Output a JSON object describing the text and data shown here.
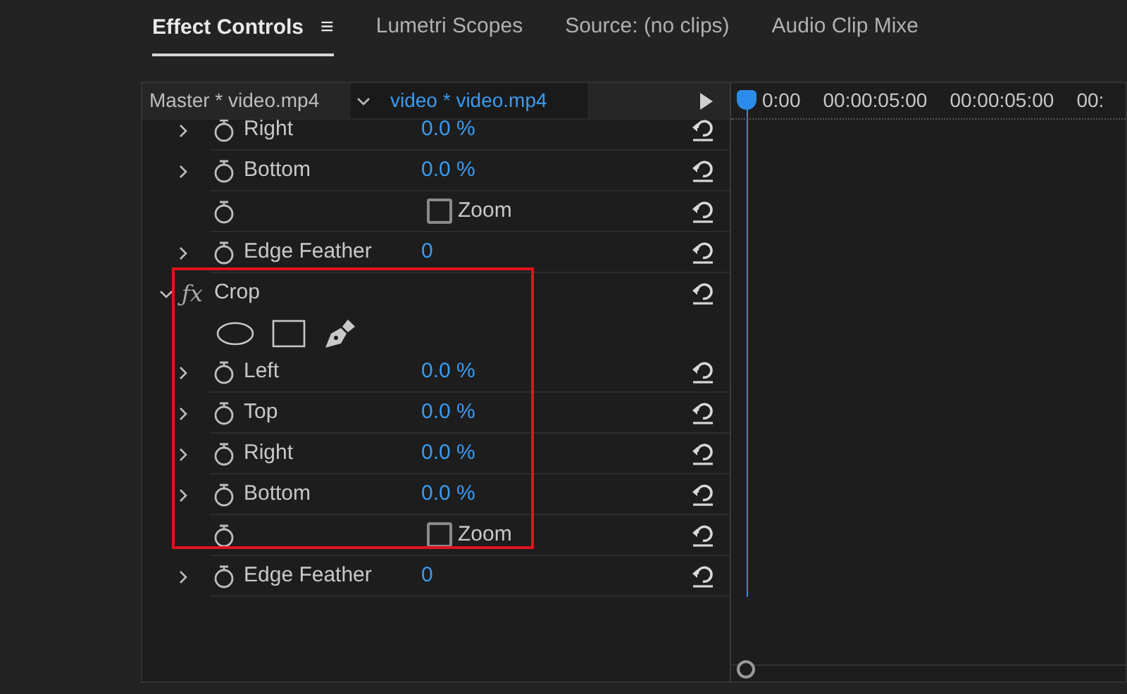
{
  "tabs": [
    {
      "label": "Effect Controls",
      "selected": true,
      "menu": "≡"
    },
    {
      "label": "Lumetri Scopes",
      "selected": false
    },
    {
      "label": "Source: (no clips)",
      "selected": false
    },
    {
      "label": "Audio Clip Mixe",
      "selected": false
    }
  ],
  "header": {
    "master": "Master * video.mp4",
    "clip": "video * video.mp4"
  },
  "timeline": {
    "ticks": [
      "0:00",
      "00:00:05:00",
      "00:00:05:00",
      "00:"
    ]
  },
  "sections": [
    {
      "rows": [
        {
          "kind": "property",
          "label": "Right",
          "value": "0.0 %",
          "expanded": false
        },
        {
          "kind": "property",
          "label": "Bottom",
          "value": "0.0 %",
          "expanded": false
        },
        {
          "kind": "checkbox",
          "label": "Zoom",
          "checked": false
        },
        {
          "kind": "property",
          "label": "Edge Feather",
          "value": "0",
          "expanded": false
        }
      ]
    },
    {
      "highlighted": true,
      "effect": {
        "icon": "ƒx",
        "name": "Crop",
        "expanded": true
      },
      "rows": [
        {
          "kind": "mask-tools"
        },
        {
          "kind": "property",
          "label": "Left",
          "value": "0.0 %",
          "expanded": false
        },
        {
          "kind": "property",
          "label": "Top",
          "value": "0.0 %",
          "expanded": false
        },
        {
          "kind": "property",
          "label": "Right",
          "value": "0.0 %",
          "expanded": false
        },
        {
          "kind": "property",
          "label": "Bottom",
          "value": "0.0 %",
          "expanded": false
        },
        {
          "kind": "checkbox",
          "label": "Zoom",
          "checked": false
        }
      ]
    },
    {
      "rows": [
        {
          "kind": "property",
          "label": "Edge Feather",
          "value": "0",
          "expanded": false
        }
      ]
    }
  ]
}
